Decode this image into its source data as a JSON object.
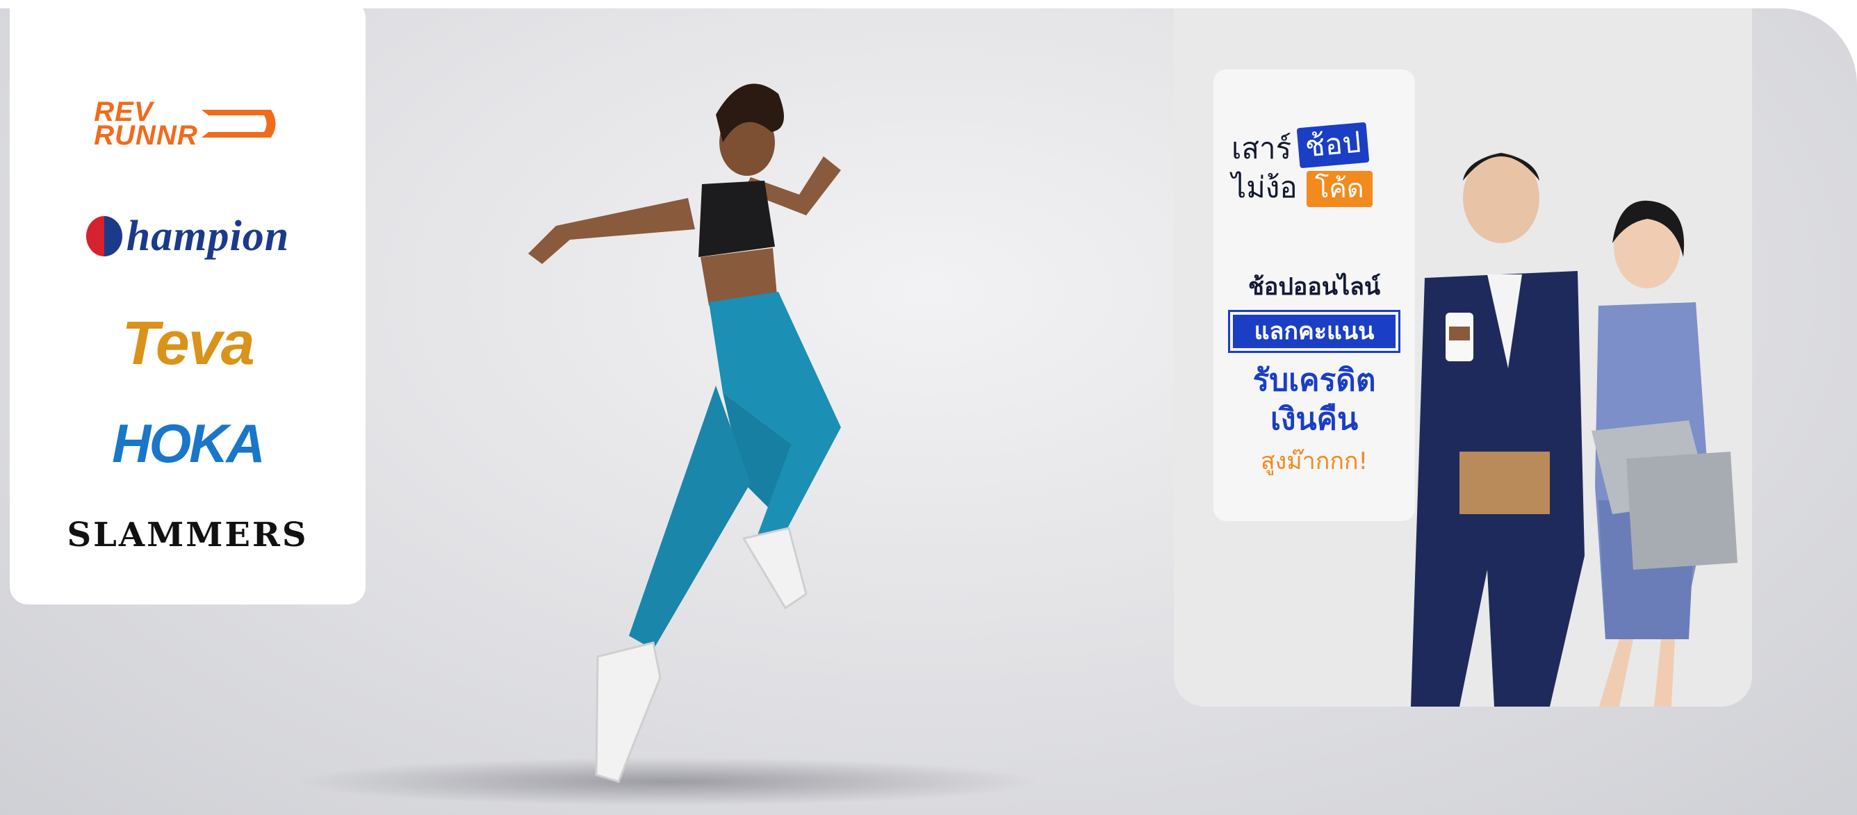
{
  "brands": {
    "rev_runnr": [
      "REV",
      "RUNNR"
    ],
    "champion": "hampion",
    "teva": "Teva",
    "hoka": "HOKA",
    "slammers": "SLAMMERS"
  },
  "promo": {
    "slogan_line1_prefix": "เสาร์",
    "slogan_line1_tag": "ช้อป",
    "slogan_line2_prefix": "ไม่ง้อ",
    "slogan_line2_tag": "โค้ด",
    "line1": "ช้อปออนไลน์",
    "line2": "แลกคะแนน",
    "line3a": "รับเครดิต",
    "line3b": "เงินคืน",
    "line4": "สูงม๊ากกก!"
  },
  "colors": {
    "accent_blue": "#1a3ec4",
    "accent_orange": "#f28a1e",
    "rev_orange": "#f26a1b",
    "teva_gold": "#d9931a",
    "hoka_blue": "#1a76c8",
    "champion_navy": "#1b3a8a"
  }
}
